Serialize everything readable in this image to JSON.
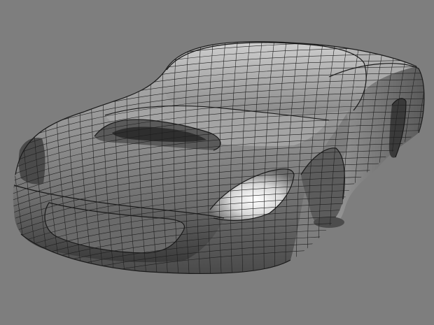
{
  "scene": {
    "subject": "car-body-wireframe",
    "colors": {
      "background": "#7e7e7e",
      "body_dark": "#3c3c3c",
      "body_mid": "#8a8a8a",
      "body_light": "#c8c8c8",
      "highlight": "#f4f4f4",
      "wire": "#1e1e1e"
    }
  }
}
